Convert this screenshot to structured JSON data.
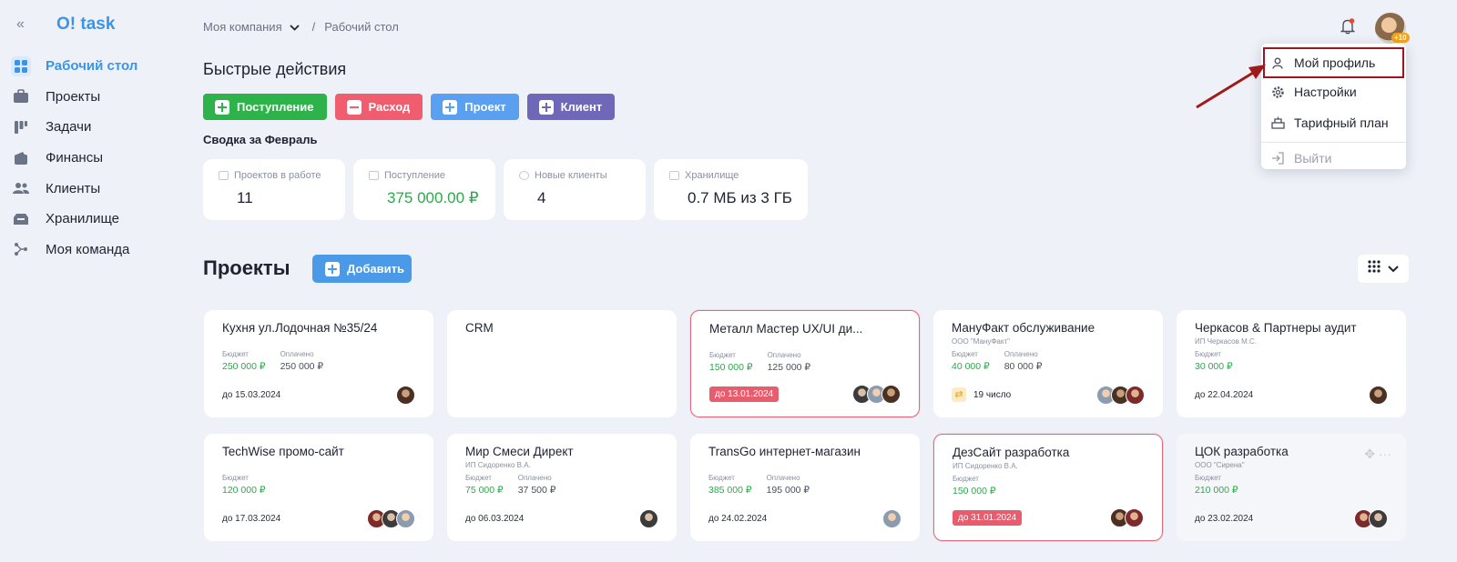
{
  "app": {
    "logo": "O! task",
    "collapse": "«"
  },
  "sidebar": {
    "items": [
      {
        "label": "Рабочий стол",
        "icon": "dashboard-icon",
        "active": true
      },
      {
        "label": "Проекты",
        "icon": "briefcase-icon"
      },
      {
        "label": "Задачи",
        "icon": "tasks-icon"
      },
      {
        "label": "Финансы",
        "icon": "wallet-icon"
      },
      {
        "label": "Клиенты",
        "icon": "users-icon"
      },
      {
        "label": "Хранилище",
        "icon": "storage-icon"
      },
      {
        "label": "Моя команда",
        "icon": "team-icon"
      }
    ]
  },
  "breadcrumb": {
    "company": "Моя компания",
    "separator": "/",
    "current": "Рабочий стол"
  },
  "quick": {
    "title": "Быстрые действия",
    "buttons": [
      {
        "label": "Поступление",
        "color": "#2db34a",
        "sign": "plus"
      },
      {
        "label": "Расход",
        "color": "#ef5d6f",
        "sign": "minus"
      },
      {
        "label": "Проект",
        "color": "#5b9ff0",
        "sign": "plus"
      },
      {
        "label": "Клиент",
        "color": "#6f67b8",
        "sign": "plus"
      }
    ]
  },
  "summary": {
    "title": "Сводка за Февраль",
    "stats": [
      {
        "label": "Проектов в работе",
        "value": "11"
      },
      {
        "label": "Поступление",
        "value": "375 000.00 ₽",
        "color": "#2ea84b"
      },
      {
        "label": "Новые клиенты",
        "value": "4"
      },
      {
        "label": "Хранилище",
        "value": "0.7 МБ из 3 ГБ"
      }
    ]
  },
  "projects": {
    "title": "Проекты",
    "add_label": "Добавить",
    "budget_label": "Бюджет",
    "paid_label": "Оплачено",
    "cards": [
      {
        "title": "Кухня ул.Лодочная №35/24",
        "client": "",
        "budget": "250 000 ₽",
        "paid": "250 000 ₽",
        "deadline": "до 15.03.2024",
        "overdue": false,
        "avatars": 1
      },
      {
        "title": "CRM",
        "client": "",
        "budget": "",
        "paid": "",
        "deadline": "",
        "overdue": false,
        "avatars": 0
      },
      {
        "title": "Металл Мастер UX/UI ди...",
        "client": "",
        "budget": "150 000 ₽",
        "paid": "125 000 ₽",
        "deadline": "до 13.01.2024",
        "overdue": true,
        "avatars": 3
      },
      {
        "title": "МануФакт обслуживание",
        "client": "ООО \"МануФакт\"",
        "budget": "40 000 ₽",
        "paid": "80 000 ₽",
        "recurring": "19 число",
        "overdue": false,
        "avatars": 3
      },
      {
        "title": "Черкасов & Партнеры аудит",
        "client": "ИП Черкасов М.С.",
        "budget": "30 000 ₽",
        "paid": "",
        "deadline": "до 22.04.2024",
        "overdue": false,
        "avatars": 1
      },
      {
        "title": "TechWise промо-сайт",
        "client": "",
        "budget": "120 000 ₽",
        "paid": "",
        "deadline": "до 17.03.2024",
        "overdue": false,
        "avatars": 3
      },
      {
        "title": "Мир Смеси Директ",
        "client": "ИП Сидоренко В.А.",
        "budget": "75 000 ₽",
        "paid": "37 500 ₽",
        "deadline": "до 06.03.2024",
        "overdue": false,
        "avatars": 1
      },
      {
        "title": "TransGo интернет-магазин",
        "client": "",
        "budget": "385 000 ₽",
        "paid": "195 000 ₽",
        "deadline": "до 24.02.2024",
        "overdue": false,
        "avatars": 1
      },
      {
        "title": "ДезСайт разработка",
        "client": "ИП Сидоренко В.А.",
        "budget": "150 000 ₽",
        "paid": "",
        "deadline": "до 31.01.2024",
        "overdue": true,
        "avatars": 2
      },
      {
        "title": "ЦОК разработка",
        "client": "ООО \"Сирена\"",
        "budget": "210 000 ₽",
        "paid": "",
        "deadline": "до 23.02.2024",
        "overdue": false,
        "avatars": 2,
        "dim": true,
        "tools": "✥ ···"
      }
    ]
  },
  "header": {
    "avatar_badge": "+10"
  },
  "profile_menu": {
    "items": [
      {
        "label": "Мой профиль",
        "icon": "user-icon",
        "highlight": true
      },
      {
        "label": "Настройки",
        "icon": "gear-icon"
      },
      {
        "label": "Тарифный план",
        "icon": "plan-icon"
      },
      {
        "label": "Выйти",
        "icon": "logout-icon",
        "disabled": true
      }
    ]
  }
}
